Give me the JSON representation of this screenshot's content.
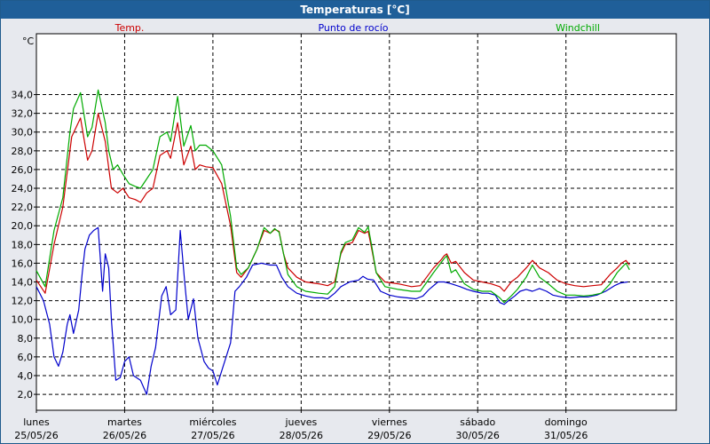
{
  "window": {
    "title": "Temperaturas [°C]"
  },
  "chart_data": {
    "type": "line",
    "ylabel": "°C",
    "ylim": [
      0.3,
      40.5
    ],
    "yticks": [
      2.0,
      4.0,
      6.0,
      8.0,
      10.0,
      12.0,
      14.0,
      16.0,
      18.0,
      20.0,
      22.0,
      24.0,
      26.0,
      28.0,
      30.0,
      32.0,
      34.0
    ],
    "ytick_labels": [
      "2,0",
      "4,0",
      "6,0",
      "8,0",
      "10,0",
      "12,0",
      "14,0",
      "16,0",
      "18,0",
      "20,0",
      "22,0",
      "24,0",
      "26,0",
      "28,0",
      "30,0",
      "32,0",
      "34,0"
    ],
    "xlim": [
      0,
      7.25
    ],
    "days": [
      {
        "day": "lunes",
        "date": "25/05/26"
      },
      {
        "day": "martes",
        "date": "26/05/26"
      },
      {
        "day": "miércoles",
        "date": "27/05/26"
      },
      {
        "day": "jueves",
        "date": "28/05/26"
      },
      {
        "day": "viernes",
        "date": "29/05/26"
      },
      {
        "day": "sábado",
        "date": "30/05/26"
      },
      {
        "day": "domingo",
        "date": "31/05/26"
      }
    ],
    "grid": true,
    "series": [
      {
        "name": "Temp.",
        "color": "#cc0000",
        "points": [
          [
            0.0,
            14.2
          ],
          [
            0.1,
            12.8
          ],
          [
            0.2,
            18.0
          ],
          [
            0.3,
            22.0
          ],
          [
            0.4,
            29.5
          ],
          [
            0.5,
            31.5
          ],
          [
            0.58,
            27.0
          ],
          [
            0.63,
            28.0
          ],
          [
            0.7,
            32.0
          ],
          [
            0.78,
            29.0
          ],
          [
            0.85,
            24.0
          ],
          [
            0.92,
            23.5
          ],
          [
            0.98,
            24.0
          ],
          [
            1.05,
            23.0
          ],
          [
            1.12,
            22.8
          ],
          [
            1.18,
            22.5
          ],
          [
            1.25,
            23.5
          ],
          [
            1.32,
            24.0
          ],
          [
            1.4,
            27.5
          ],
          [
            1.48,
            28.0
          ],
          [
            1.52,
            27.2
          ],
          [
            1.6,
            31.0
          ],
          [
            1.67,
            26.5
          ],
          [
            1.75,
            28.5
          ],
          [
            1.8,
            26.0
          ],
          [
            1.85,
            26.5
          ],
          [
            1.92,
            26.3
          ],
          [
            2.0,
            26.2
          ],
          [
            2.1,
            24.5
          ],
          [
            2.2,
            20.0
          ],
          [
            2.27,
            15.0
          ],
          [
            2.32,
            14.5
          ],
          [
            2.4,
            15.5
          ],
          [
            2.5,
            17.5
          ],
          [
            2.58,
            19.5
          ],
          [
            2.65,
            19.2
          ],
          [
            2.7,
            19.6
          ],
          [
            2.75,
            19.4
          ],
          [
            2.8,
            17.0
          ],
          [
            2.85,
            15.5
          ],
          [
            2.95,
            14.5
          ],
          [
            3.05,
            14.0
          ],
          [
            3.2,
            13.8
          ],
          [
            3.3,
            13.6
          ],
          [
            3.38,
            14.0
          ],
          [
            3.45,
            17.0
          ],
          [
            3.5,
            18.0
          ],
          [
            3.58,
            18.2
          ],
          [
            3.65,
            19.5
          ],
          [
            3.72,
            19.2
          ],
          [
            3.76,
            19.4
          ],
          [
            3.8,
            17.5
          ],
          [
            3.85,
            15.0
          ],
          [
            3.95,
            14.0
          ],
          [
            4.1,
            13.8
          ],
          [
            4.25,
            13.5
          ],
          [
            4.35,
            13.6
          ],
          [
            4.5,
            15.5
          ],
          [
            4.58,
            16.3
          ],
          [
            4.62,
            16.8
          ],
          [
            4.65,
            17.0
          ],
          [
            4.7,
            16.0
          ],
          [
            4.75,
            16.2
          ],
          [
            4.85,
            15.0
          ],
          [
            4.95,
            14.2
          ],
          [
            5.05,
            14.0
          ],
          [
            5.15,
            13.8
          ],
          [
            5.25,
            13.5
          ],
          [
            5.3,
            13.0
          ],
          [
            5.38,
            14.0
          ],
          [
            5.45,
            14.5
          ],
          [
            5.55,
            15.5
          ],
          [
            5.62,
            16.3
          ],
          [
            5.7,
            15.5
          ],
          [
            5.8,
            15.0
          ],
          [
            5.9,
            14.2
          ],
          [
            6.0,
            13.8
          ],
          [
            6.1,
            13.6
          ],
          [
            6.2,
            13.5
          ],
          [
            6.3,
            13.6
          ],
          [
            6.4,
            13.7
          ],
          [
            6.5,
            14.8
          ],
          [
            6.58,
            15.5
          ],
          [
            6.63,
            16.0
          ],
          [
            6.68,
            16.3
          ],
          [
            6.72,
            15.8
          ]
        ]
      },
      {
        "name": "Punto de rocío",
        "color": "#0000cc",
        "points": [
          [
            0.0,
            13.5
          ],
          [
            0.08,
            12.0
          ],
          [
            0.15,
            9.5
          ],
          [
            0.2,
            6.0
          ],
          [
            0.25,
            5.0
          ],
          [
            0.3,
            6.5
          ],
          [
            0.35,
            9.5
          ],
          [
            0.38,
            10.5
          ],
          [
            0.42,
            8.5
          ],
          [
            0.48,
            11.0
          ],
          [
            0.52,
            15.0
          ],
          [
            0.55,
            17.5
          ],
          [
            0.6,
            19.0
          ],
          [
            0.65,
            19.5
          ],
          [
            0.7,
            19.8
          ],
          [
            0.75,
            13.0
          ],
          [
            0.78,
            17.0
          ],
          [
            0.82,
            15.5
          ],
          [
            0.85,
            10.0
          ],
          [
            0.9,
            3.5
          ],
          [
            0.95,
            3.8
          ],
          [
            1.0,
            5.5
          ],
          [
            1.05,
            6.0
          ],
          [
            1.1,
            4.0
          ],
          [
            1.18,
            3.5
          ],
          [
            1.25,
            2.0
          ],
          [
            1.3,
            5.0
          ],
          [
            1.35,
            7.0
          ],
          [
            1.42,
            12.5
          ],
          [
            1.47,
            13.5
          ],
          [
            1.52,
            10.5
          ],
          [
            1.58,
            11.0
          ],
          [
            1.63,
            19.5
          ],
          [
            1.68,
            14.0
          ],
          [
            1.72,
            10.0
          ],
          [
            1.78,
            12.2
          ],
          [
            1.83,
            8.0
          ],
          [
            1.9,
            5.5
          ],
          [
            1.95,
            4.8
          ],
          [
            2.0,
            4.5
          ],
          [
            2.05,
            3.0
          ],
          [
            2.1,
            4.5
          ],
          [
            2.15,
            6.0
          ],
          [
            2.2,
            7.5
          ],
          [
            2.25,
            13.0
          ],
          [
            2.3,
            13.5
          ],
          [
            2.38,
            14.5
          ],
          [
            2.45,
            15.8
          ],
          [
            2.55,
            16.0
          ],
          [
            2.65,
            15.8
          ],
          [
            2.72,
            15.8
          ],
          [
            2.78,
            14.5
          ],
          [
            2.85,
            13.5
          ],
          [
            2.95,
            12.8
          ],
          [
            3.05,
            12.5
          ],
          [
            3.15,
            12.3
          ],
          [
            3.25,
            12.3
          ],
          [
            3.3,
            12.2
          ],
          [
            3.38,
            12.8
          ],
          [
            3.45,
            13.5
          ],
          [
            3.55,
            14.0
          ],
          [
            3.65,
            14.2
          ],
          [
            3.7,
            14.6
          ],
          [
            3.75,
            14.3
          ],
          [
            3.82,
            14.2
          ],
          [
            3.9,
            13.0
          ],
          [
            4.0,
            12.6
          ],
          [
            4.1,
            12.4
          ],
          [
            4.2,
            12.3
          ],
          [
            4.3,
            12.2
          ],
          [
            4.38,
            12.5
          ],
          [
            4.45,
            13.2
          ],
          [
            4.55,
            14.0
          ],
          [
            4.62,
            14.0
          ],
          [
            4.7,
            13.8
          ],
          [
            4.8,
            13.5
          ],
          [
            4.88,
            13.2
          ],
          [
            4.95,
            13.0
          ],
          [
            5.05,
            12.8
          ],
          [
            5.12,
            12.8
          ],
          [
            5.2,
            12.6
          ],
          [
            5.25,
            11.8
          ],
          [
            5.3,
            11.6
          ],
          [
            5.35,
            12.0
          ],
          [
            5.42,
            12.5
          ],
          [
            5.48,
            13.0
          ],
          [
            5.55,
            13.2
          ],
          [
            5.62,
            13.0
          ],
          [
            5.7,
            13.3
          ],
          [
            5.78,
            13.0
          ],
          [
            5.85,
            12.6
          ],
          [
            5.95,
            12.4
          ],
          [
            6.05,
            12.3
          ],
          [
            6.15,
            12.4
          ],
          [
            6.25,
            12.4
          ],
          [
            6.35,
            12.6
          ],
          [
            6.45,
            13.0
          ],
          [
            6.55,
            13.6
          ],
          [
            6.62,
            13.9
          ],
          [
            6.7,
            14.0
          ]
        ]
      },
      {
        "name": "Windchill",
        "color": "#00aa00",
        "points": [
          [
            0.0,
            15.2
          ],
          [
            0.1,
            13.5
          ],
          [
            0.2,
            19.5
          ],
          [
            0.3,
            23.0
          ],
          [
            0.38,
            30.0
          ],
          [
            0.42,
            32.5
          ],
          [
            0.5,
            34.2
          ],
          [
            0.58,
            29.5
          ],
          [
            0.63,
            30.5
          ],
          [
            0.7,
            34.5
          ],
          [
            0.78,
            31.0
          ],
          [
            0.82,
            28.0
          ],
          [
            0.87,
            26.0
          ],
          [
            0.92,
            26.5
          ],
          [
            0.98,
            25.5
          ],
          [
            1.05,
            24.5
          ],
          [
            1.12,
            24.2
          ],
          [
            1.18,
            24.0
          ],
          [
            1.25,
            25.0
          ],
          [
            1.32,
            26.0
          ],
          [
            1.4,
            29.5
          ],
          [
            1.48,
            30.0
          ],
          [
            1.52,
            29.0
          ],
          [
            1.6,
            33.8
          ],
          [
            1.67,
            28.5
          ],
          [
            1.75,
            30.7
          ],
          [
            1.8,
            28.0
          ],
          [
            1.85,
            28.6
          ],
          [
            1.92,
            28.6
          ],
          [
            2.0,
            28.0
          ],
          [
            2.1,
            26.5
          ],
          [
            2.2,
            21.0
          ],
          [
            2.27,
            15.5
          ],
          [
            2.32,
            14.8
          ],
          [
            2.4,
            15.5
          ],
          [
            2.5,
            17.5
          ],
          [
            2.58,
            19.8
          ],
          [
            2.65,
            19.2
          ],
          [
            2.7,
            19.7
          ],
          [
            2.75,
            19.3
          ],
          [
            2.8,
            17.0
          ],
          [
            2.85,
            14.8
          ],
          [
            2.95,
            13.5
          ],
          [
            3.05,
            13.0
          ],
          [
            3.2,
            12.8
          ],
          [
            3.3,
            12.7
          ],
          [
            3.38,
            13.5
          ],
          [
            3.45,
            17.2
          ],
          [
            3.5,
            18.2
          ],
          [
            3.58,
            18.5
          ],
          [
            3.65,
            19.8
          ],
          [
            3.72,
            19.3
          ],
          [
            3.76,
            19.9
          ],
          [
            3.8,
            17.8
          ],
          [
            3.85,
            15.0
          ],
          [
            3.95,
            13.5
          ],
          [
            4.1,
            13.2
          ],
          [
            4.25,
            13.0
          ],
          [
            4.35,
            13.0
          ],
          [
            4.5,
            15.0
          ],
          [
            4.58,
            16.0
          ],
          [
            4.62,
            16.5
          ],
          [
            4.65,
            16.8
          ],
          [
            4.7,
            15.0
          ],
          [
            4.75,
            15.3
          ],
          [
            4.85,
            13.8
          ],
          [
            4.95,
            13.2
          ],
          [
            5.05,
            13.0
          ],
          [
            5.15,
            13.0
          ],
          [
            5.25,
            12.3
          ],
          [
            5.3,
            11.8
          ],
          [
            5.38,
            12.5
          ],
          [
            5.45,
            13.2
          ],
          [
            5.55,
            14.5
          ],
          [
            5.62,
            15.8
          ],
          [
            5.7,
            14.5
          ],
          [
            5.8,
            13.8
          ],
          [
            5.9,
            13.0
          ],
          [
            6.0,
            12.6
          ],
          [
            6.1,
            12.6
          ],
          [
            6.2,
            12.5
          ],
          [
            6.3,
            12.6
          ],
          [
            6.4,
            12.8
          ],
          [
            6.5,
            13.8
          ],
          [
            6.58,
            15.0
          ],
          [
            6.63,
            15.5
          ],
          [
            6.68,
            16.0
          ],
          [
            6.72,
            15.3
          ]
        ]
      }
    ]
  }
}
